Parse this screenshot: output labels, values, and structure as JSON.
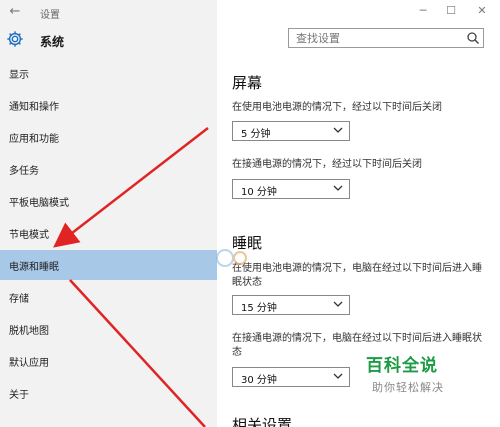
{
  "window": {
    "title": "设置",
    "controls": {
      "minimize": "─",
      "maximize": "☐",
      "close": "✕"
    },
    "back_symbol": "←"
  },
  "header": {
    "section_title": "系统",
    "search": {
      "placeholder": "查找设置",
      "value": ""
    }
  },
  "sidebar": {
    "items": [
      {
        "label": "显示"
      },
      {
        "label": "通知和操作"
      },
      {
        "label": "应用和功能"
      },
      {
        "label": "多任务"
      },
      {
        "label": "平板电脑模式"
      },
      {
        "label": "节电模式"
      },
      {
        "label": "电源和睡眠",
        "active": true
      },
      {
        "label": "存储"
      },
      {
        "label": "脱机地图"
      },
      {
        "label": "默认应用"
      },
      {
        "label": "关于"
      }
    ]
  },
  "main": {
    "screen": {
      "heading": "屏幕",
      "battery_label": "在使用电池电源的情况下，经过以下时间后关闭",
      "battery_value": "5 分钟",
      "plugged_label": "在接通电源的情况下，经过以下时间后关闭",
      "plugged_value": "10 分钟"
    },
    "sleep": {
      "heading": "睡眠",
      "battery_label": "在使用电池电源的情况下，电脑在经过以下时间后进入睡眠状态",
      "battery_value": "15 分钟",
      "plugged_label": "在接通电源的情况下，电脑在经过以下时间后进入睡眠状态",
      "plugged_value": "30 分钟"
    },
    "related_heading": "相关设置"
  },
  "watermark": {
    "title": "百科全说",
    "subtitle": "助你轻松解决"
  },
  "colors": {
    "sidebar_bg": "#f2f2f2",
    "active_item_bg": "#a8c8e8",
    "accent_blue": "#1e6fc1",
    "arrow_red": "#e02424",
    "watermark_green": "#1c9b45"
  },
  "icons": {
    "back": "back-arrow-icon",
    "settings": "gear-icon",
    "search": "search-icon",
    "dropdown": "chevron-down-icon"
  }
}
